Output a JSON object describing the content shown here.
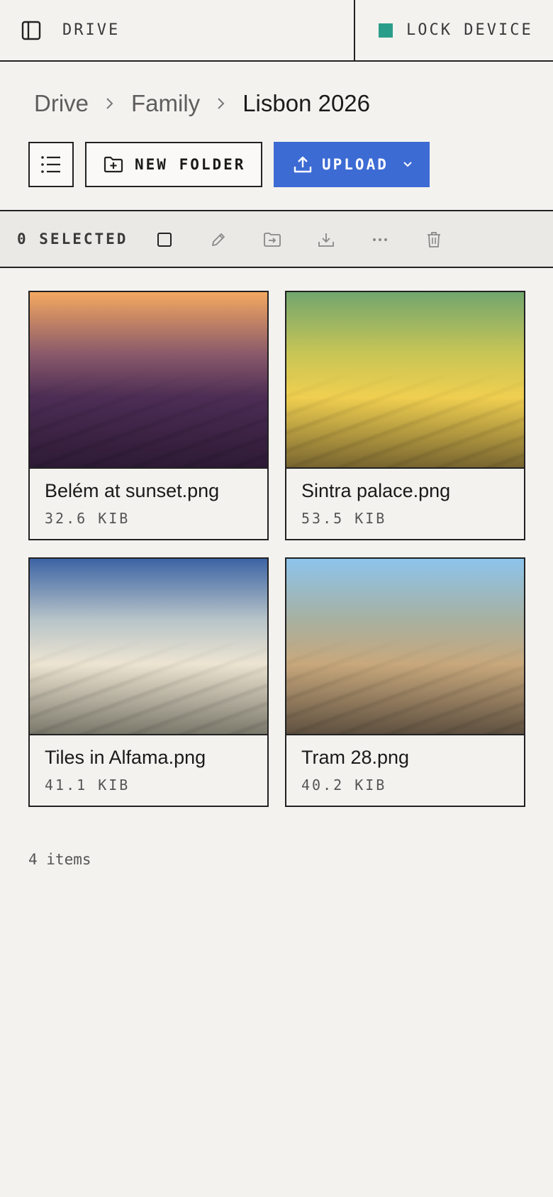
{
  "topbar": {
    "drive_label": "DRIVE",
    "lock_label": "LOCK DEVICE",
    "lock_color": "#2a9d8a"
  },
  "breadcrumb": {
    "items": [
      "Drive",
      "Family"
    ],
    "current": "Lisbon 2026"
  },
  "actions": {
    "new_folder_label": "NEW FOLDER",
    "upload_label": "UPLOAD",
    "upload_color": "#3d6bd4"
  },
  "selection": {
    "count_label": "0 SELECTED",
    "tools": [
      "checkbox-icon",
      "pencil-icon",
      "move-icon",
      "download-icon",
      "more-icon",
      "trash-icon"
    ]
  },
  "files": [
    {
      "name": "Belém at sunset.png",
      "size": "32.6 KIB",
      "gradient": [
        "#f4a860",
        "#8a5a6a",
        "#4d2d55",
        "#2d1a35"
      ]
    },
    {
      "name": "Sintra palace.png",
      "size": "53.5 KIB",
      "gradient": [
        "#72a66e",
        "#c8c555",
        "#f0cf50",
        "#786530"
      ]
    },
    {
      "name": "Tiles in Alfama.png",
      "size": "41.1 KIB",
      "gradient": [
        "#3c64a4",
        "#b8c4c8",
        "#ede4d2",
        "#7a786a"
      ]
    },
    {
      "name": "Tram 28.png",
      "size": "40.2 KIB",
      "gradient": [
        "#8cc4ec",
        "#a8b0a0",
        "#c8a87c",
        "#5e5040"
      ]
    }
  ],
  "footer": {
    "items_count": "4 items"
  }
}
